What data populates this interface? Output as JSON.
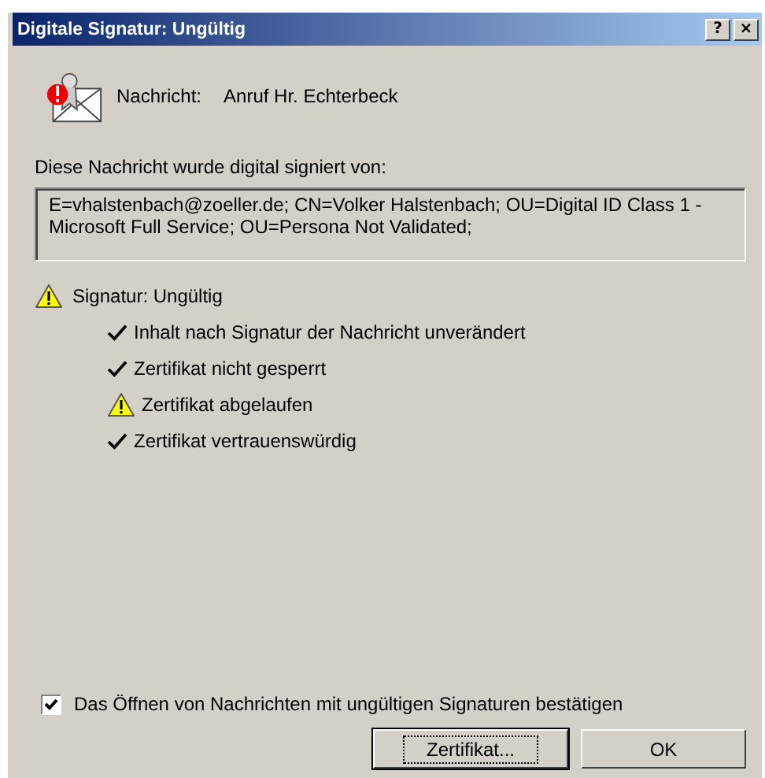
{
  "window": {
    "title": "Digitale Signatur: Ungültig",
    "title_buttons": [
      "?",
      "×"
    ]
  },
  "message": {
    "label": "Nachricht:",
    "subject": "Anruf Hr. Echterbeck"
  },
  "signed_by_label": "Diese Nachricht wurde digital signiert von:",
  "signer": "E=vhalstenbach@zoeller.de; CN=Volker Halstenbach; OU=Digital ID Class 1 - Microsoft Full Service; OU=Persona Not Validated;",
  "status": {
    "kind": "warning",
    "text": "Signatur: Ungültig"
  },
  "checks": [
    {
      "kind": "check",
      "text": "Inhalt nach Signatur der Nachricht unverändert"
    },
    {
      "kind": "check",
      "text": "Zertifikat nicht gesperrt"
    },
    {
      "kind": "warning",
      "text": "Zertifikat abgelaufen"
    },
    {
      "kind": "check",
      "text": "Zertifikat vertrauenswürdig"
    }
  ],
  "confirm": {
    "label": "Das Öffnen von Nachrichten mit ungültigen Signaturen bestätigen",
    "checked": true
  },
  "buttons": [
    {
      "label": "Zertifikat...",
      "focused": true
    },
    {
      "label": "OK",
      "focused": false
    }
  ]
}
